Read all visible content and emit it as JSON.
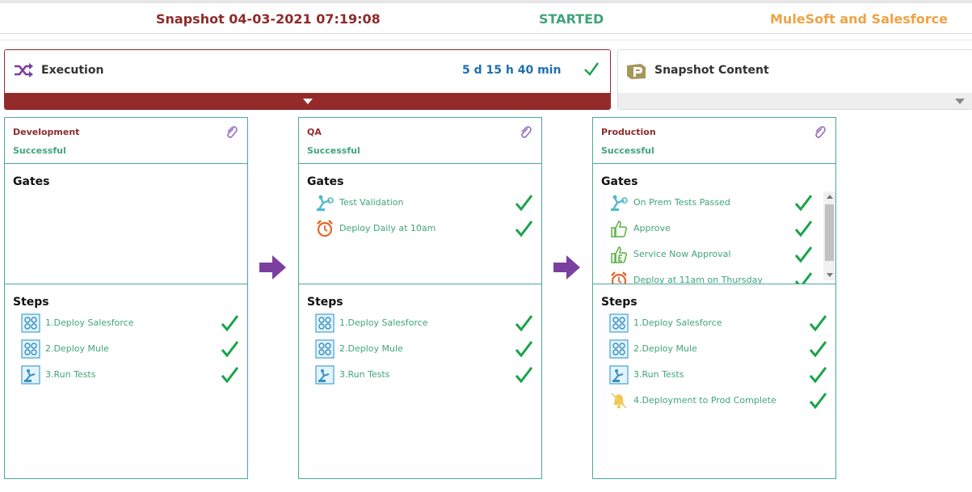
{
  "header": {
    "snapshot": "Snapshot 04-03-2021 07:19:08",
    "status": "STARTED",
    "project": "MuleSoft and Salesforce"
  },
  "execution": {
    "label": "Execution",
    "duration": "5 d 15 h 40 min",
    "icon": "shuffle-icon"
  },
  "snapshot_content": {
    "label": "Snapshot Content",
    "icon": "package-icon"
  },
  "stages": [
    {
      "name": "Development",
      "status": "Successful",
      "gates_title": "Gates",
      "gates": [],
      "steps_title": "Steps",
      "steps": [
        {
          "label": "1.Deploy Salesforce",
          "icon": "deploy-icon"
        },
        {
          "label": "2.Deploy Mule",
          "icon": "deploy-icon"
        },
        {
          "label": "3.Run Tests",
          "icon": "robot-icon"
        }
      ]
    },
    {
      "name": "QA",
      "status": "Successful",
      "gates_title": "Gates",
      "gates": [
        {
          "label": "Test Validation",
          "icon": "robot-arm-icon"
        },
        {
          "label": "Deploy Daily at 10am",
          "icon": "alarm-clock-icon"
        }
      ],
      "steps_title": "Steps",
      "steps": [
        {
          "label": "1.Deploy Salesforce",
          "icon": "deploy-icon"
        },
        {
          "label": "2.Deploy Mule",
          "icon": "deploy-icon"
        },
        {
          "label": "3.Run Tests",
          "icon": "robot-icon"
        }
      ]
    },
    {
      "name": "Production",
      "status": "Successful",
      "gates_title": "Gates",
      "gates": [
        {
          "label": "On Prem Tests Passed",
          "icon": "robot-arm-icon"
        },
        {
          "label": "Approve",
          "icon": "thumbs-up-icon"
        },
        {
          "label": "Service Now Approval",
          "icon": "thumbs-up-e-icon"
        },
        {
          "label": "Deploy at 11am on Thursday",
          "icon": "alarm-clock-icon"
        }
      ],
      "steps_title": "Steps",
      "steps": [
        {
          "label": "1.Deploy Salesforce",
          "icon": "deploy-icon"
        },
        {
          "label": "2.Deploy Mule",
          "icon": "deploy-icon"
        },
        {
          "label": "3.Run Tests",
          "icon": "robot-icon"
        },
        {
          "label": "4.Deployment to Prod Complete",
          "icon": "bell-off-icon"
        }
      ]
    }
  ],
  "colors": {
    "accent_red": "#952a2a",
    "success_green": "#3fa57a",
    "check_green": "#1aa34a",
    "info_blue": "#1f6fae",
    "project_orange": "#f0a244",
    "flow_arrow": "#7b3fa0"
  }
}
